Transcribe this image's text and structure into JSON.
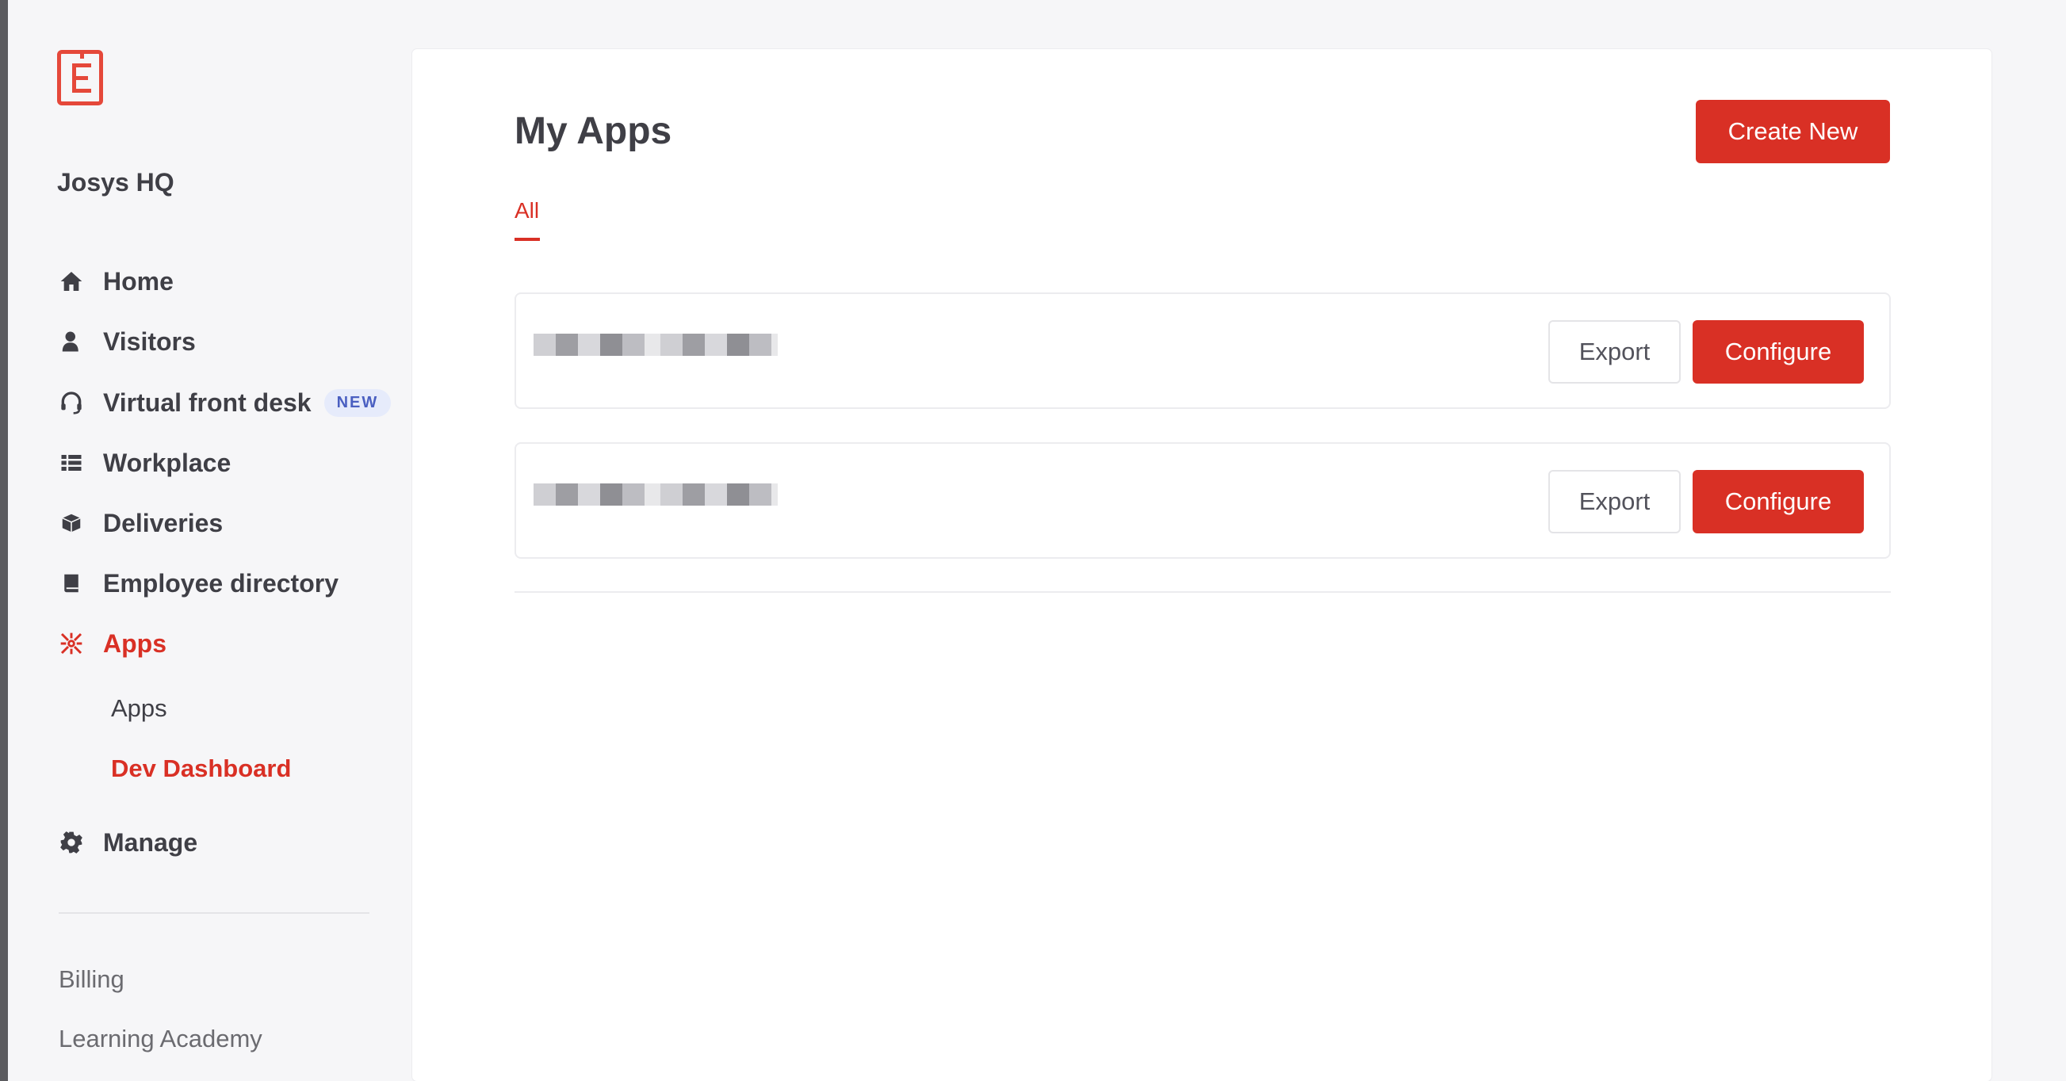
{
  "sidebar": {
    "org_name": "Josys HQ",
    "nav": [
      {
        "label": "Home",
        "icon": "home-icon"
      },
      {
        "label": "Visitors",
        "icon": "visitor-icon"
      },
      {
        "label": "Virtual front desk",
        "icon": "headset-icon",
        "badge": "NEW"
      },
      {
        "label": "Workplace",
        "icon": "list-icon"
      },
      {
        "label": "Deliveries",
        "icon": "box-icon"
      },
      {
        "label": "Employee directory",
        "icon": "book-icon"
      },
      {
        "label": "Apps",
        "icon": "apps-icon",
        "active": true
      },
      {
        "label": "Manage",
        "icon": "gear-icon"
      }
    ],
    "apps_sub": [
      {
        "label": "Apps"
      },
      {
        "label": "Dev Dashboard",
        "active": true
      }
    ],
    "footer_links": [
      "Billing",
      "Learning Academy"
    ]
  },
  "main": {
    "title": "My Apps",
    "create_button": "Create New",
    "tabs": [
      {
        "label": "All",
        "active": true
      }
    ],
    "apps": [
      {
        "name_redacted": true,
        "export_label": "Export",
        "configure_label": "Configure"
      },
      {
        "name_redacted": true,
        "export_label": "Export",
        "configure_label": "Configure"
      }
    ]
  },
  "colors": {
    "accent": "#d93025",
    "text": "#3f3f46",
    "badge_bg": "#e6ebfb",
    "badge_text": "#4a5fc1"
  }
}
